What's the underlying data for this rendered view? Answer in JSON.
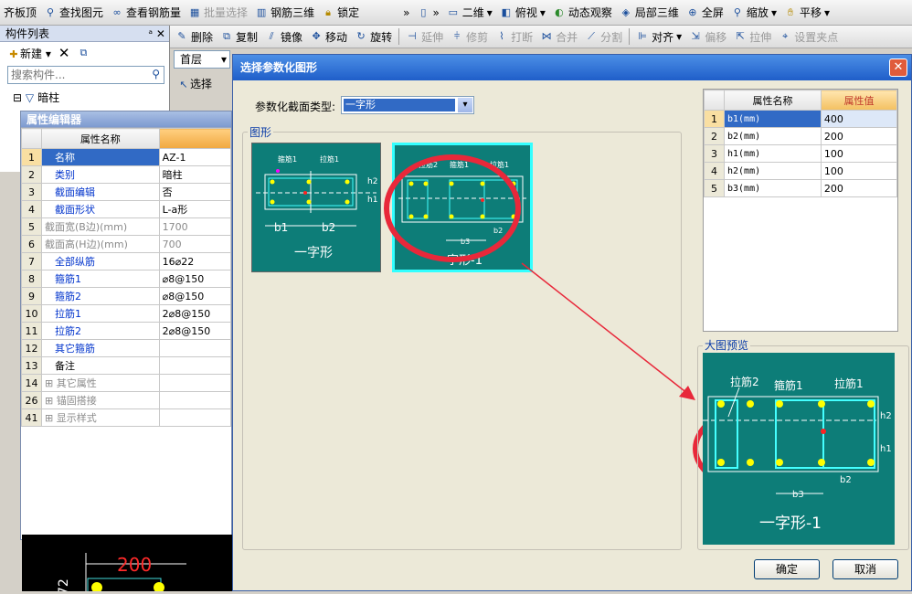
{
  "toolbar1": [
    "齐板顶",
    "查找图元",
    "查看钢筋量",
    "批量选择",
    "钢筋三维",
    "锁定",
    "二维",
    "俯视",
    "动态观察",
    "局部三维",
    "全屏",
    "缩放",
    "平移"
  ],
  "toolbar2": [
    "删除",
    "复制",
    "镜像",
    "移动",
    "旋转",
    "延伸",
    "修剪",
    "打断",
    "合并",
    "分割",
    "对齐",
    "偏移",
    "拉伸",
    "设置夹点"
  ],
  "floor": "首层",
  "select_label": "选择",
  "comp_list": {
    "title": "构件列表",
    "new": "新建",
    "search_placeholder": "搜索构件...",
    "tree_root": "暗柱"
  },
  "prop_editor": {
    "title": "属性编辑器",
    "col": "属性名称",
    "rows": [
      {
        "n": "1",
        "name": "名称",
        "val": "AZ-1"
      },
      {
        "n": "2",
        "name": "类别",
        "val": "暗柱"
      },
      {
        "n": "3",
        "name": "截面编辑",
        "val": "否"
      },
      {
        "n": "4",
        "name": "截面形状",
        "val": "L-a形"
      },
      {
        "n": "5",
        "name": "截面宽(B边)(mm)",
        "val": "1700"
      },
      {
        "n": "6",
        "name": "截面高(H边)(mm)",
        "val": "700"
      },
      {
        "n": "7",
        "name": "全部纵筋",
        "val": "16⌀22"
      },
      {
        "n": "8",
        "name": "箍筋1",
        "val": "⌀8@150"
      },
      {
        "n": "9",
        "name": "箍筋2",
        "val": "⌀8@150"
      },
      {
        "n": "10",
        "name": "拉筋1",
        "val": "2⌀8@150"
      },
      {
        "n": "11",
        "name": "拉筋2",
        "val": "2⌀8@150"
      },
      {
        "n": "12",
        "name": "其它箍筋",
        "val": ""
      },
      {
        "n": "13",
        "name": "备注",
        "val": ""
      },
      {
        "n": "14",
        "name": "其它属性",
        "val": ""
      },
      {
        "n": "26",
        "name": "锚固搭接",
        "val": ""
      },
      {
        "n": "41",
        "name": "显示样式",
        "val": ""
      }
    ]
  },
  "canvas_dim": "200",
  "dialog": {
    "title": "选择参数化图形",
    "type_label": "参数化截面类型:",
    "type_value": "一字形",
    "group_shapes": "图形",
    "group_preview": "大图预览",
    "ok": "确定",
    "cancel": "取消",
    "shapes": [
      "一字形",
      "一字形-1"
    ],
    "prop_header": [
      "属性名称",
      "属性值"
    ],
    "props": [
      {
        "n": "1",
        "name": "b1(mm)",
        "val": "400"
      },
      {
        "n": "2",
        "name": "b2(mm)",
        "val": "200"
      },
      {
        "n": "3",
        "name": "h1(mm)",
        "val": "100"
      },
      {
        "n": "4",
        "name": "h2(mm)",
        "val": "100"
      },
      {
        "n": "5",
        "name": "b3(mm)",
        "val": "200"
      }
    ],
    "preview_labels": {
      "l1": "拉筋2",
      "l2": "箍筋1",
      "l3": "拉筋1",
      "h2": "h2",
      "h1": "h1",
      "b3": "b3",
      "b2": "b2",
      "title": "一字形-1"
    },
    "thumb1": {
      "g1": "箍筋1",
      "g2": "拉筋1",
      "b1": "b1",
      "b2": "b2",
      "h1": "h1",
      "h2": "h2"
    },
    "thumb2": {
      "g1": "拉筋2",
      "g2": "箍筋1",
      "g3": "拉筋1",
      "b3": "b3",
      "b2": "b2"
    }
  },
  "colors": {
    "teal": "#0d7d78",
    "highlight": "#e8283a",
    "accent": "#316ac5"
  }
}
